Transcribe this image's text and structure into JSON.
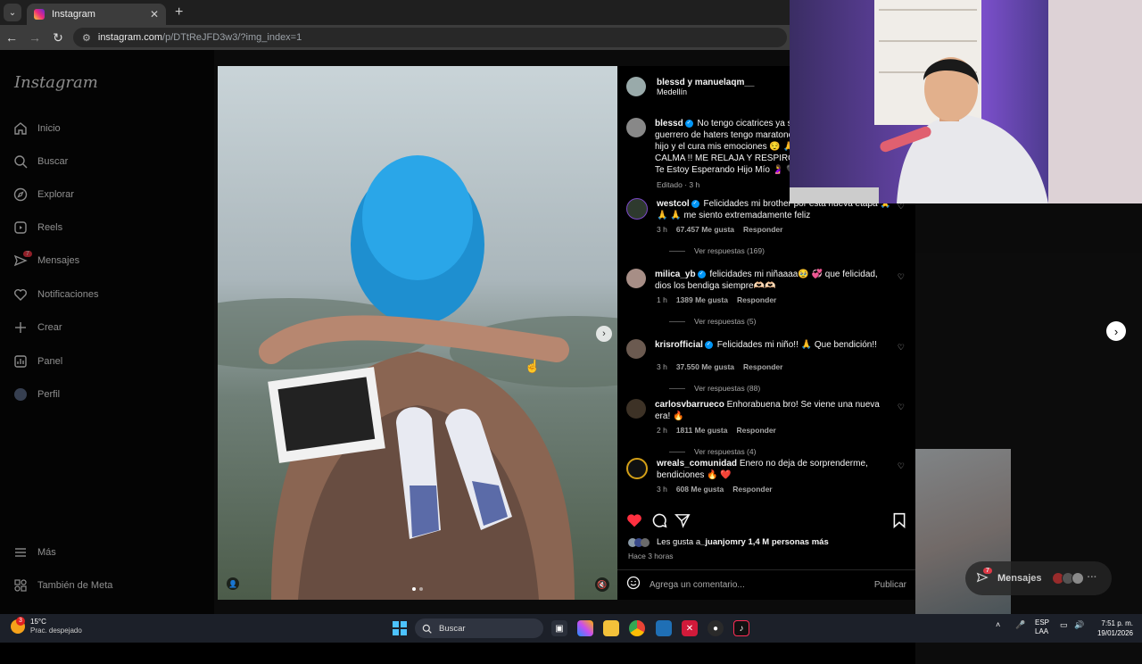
{
  "browser": {
    "tab_title": "Instagram",
    "url_host": "instagram.com",
    "url_path": "/p/DTtReJFD3w3/?img_index=1"
  },
  "sidebar": {
    "logo": "Instagram",
    "items": [
      {
        "label": "Inicio",
        "icon": "home-icon"
      },
      {
        "label": "Buscar",
        "icon": "search-icon"
      },
      {
        "label": "Explorar",
        "icon": "compass-icon"
      },
      {
        "label": "Reels",
        "icon": "reels-icon"
      },
      {
        "label": "Mensajes",
        "icon": "messenger-icon",
        "badge": "7"
      },
      {
        "label": "Notificaciones",
        "icon": "heart-icon"
      },
      {
        "label": "Crear",
        "icon": "plus-icon"
      },
      {
        "label": "Panel",
        "icon": "dashboard-icon"
      },
      {
        "label": "Perfil",
        "icon": "avatar-icon"
      }
    ],
    "more": "Más",
    "meta": "También de Meta"
  },
  "post": {
    "header_users": "blessd y manuelaqm__",
    "location": "Medellín",
    "caption_user": "blessd",
    "caption_lines": [
      "No tengo cicatrices ya sa",
      "guerrero de haters tengo maratone",
      "hijo y el cura mis emociones 😌 🙏",
      "CALMA !! ME RELAJA Y RESPIRO !!",
      "Te Estoy Esperando Hijo Mío 🤰 🖤"
    ],
    "caption_meta": "Editado · 3 h",
    "likes_text": "Les gusta a ",
    "likes_user": "_juanjomr",
    "likes_rest": " y 1,4 M personas más",
    "time_ago": "Hace 3 horas",
    "comment_placeholder": "Agrega un comentario...",
    "publish_label": "Publicar"
  },
  "comments": [
    {
      "user": "westcol",
      "verified": true,
      "text": "Felicidades mi brother por esta nueva etapa 🙏 🙏 🙏 me siento extremadamente feliz",
      "time": "3 h",
      "likes": "67.457 Me gusta",
      "reply": "Responder",
      "replies": "Ver respuestas (169)"
    },
    {
      "user": "milica_yb",
      "verified": true,
      "text": "felicidades mi niñaaaa🥹 💞 que felicidad, dios los bendiga siempre🫶🏻🫶🏻",
      "time": "1 h",
      "likes": "1389 Me gusta",
      "reply": "Responder",
      "replies": "Ver respuestas (5)"
    },
    {
      "user": "krisrofficial",
      "verified": true,
      "text": "Felicidades mi niño!! 🙏 Que bendición!!",
      "time": "3 h",
      "likes": "37.550 Me gusta",
      "reply": "Responder",
      "replies": "Ver respuestas (88)"
    },
    {
      "user": "carlosvbarrueco",
      "verified": false,
      "text": "Enhorabuena bro! Se viene una nueva era! 🔥",
      "time": "2 h",
      "likes": "1811 Me gusta",
      "reply": "Responder",
      "replies": "Ver respuestas (4)"
    },
    {
      "user": "wreals_comunidad",
      "verified": false,
      "text": "Enero no deja de sorprenderme, bendiciones 🔥 ❤️",
      "time": "3 h",
      "likes": "608 Me gusta",
      "reply": "Responder",
      "replies": ""
    }
  ],
  "messages_pill": {
    "label": "Mensajes",
    "badge": "7"
  },
  "taskbar": {
    "temp": "15°C",
    "weather": "Prac. despejado",
    "weather_alert": "3",
    "search_placeholder": "Buscar",
    "lang_top": "ESP",
    "lang_bottom": "LAA",
    "time": "7:51 p. m.",
    "date": "19/01/2026"
  },
  "colors": {
    "like_red": "#ff3040",
    "verified_blue": "#0095f6",
    "bg": "#000000"
  }
}
